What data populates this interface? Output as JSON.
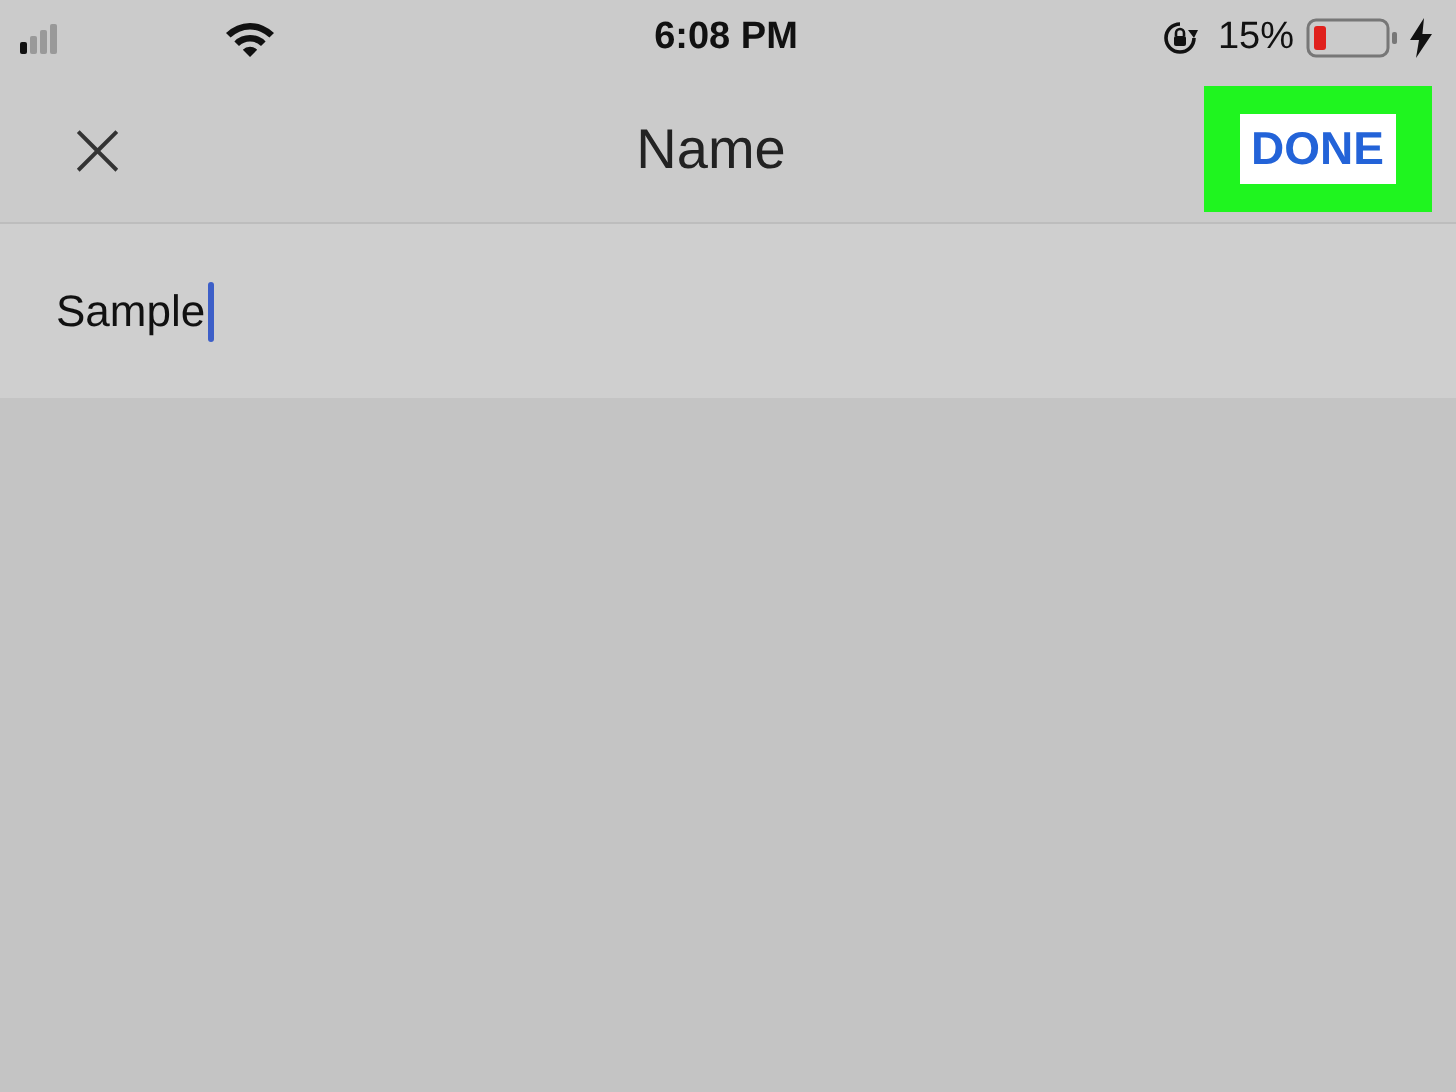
{
  "status_bar": {
    "time": "6:08 PM",
    "battery_percent": "15%"
  },
  "header": {
    "title": "Name",
    "close_glyph": "×",
    "done_label": "DONE",
    "done_highlighted": true
  },
  "name_field": {
    "value": "Sample",
    "focused": true
  }
}
